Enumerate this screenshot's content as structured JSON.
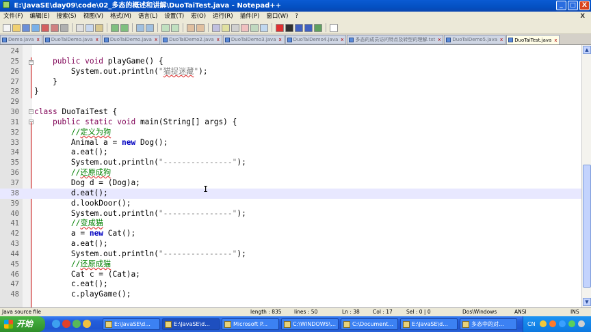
{
  "window": {
    "title": "E:\\JavaSE\\day09\\code\\02_多态的概述和讲解\\DuoTaiTest.java - Notepad++",
    "controls": [
      "_",
      "□",
      "X"
    ]
  },
  "menu": {
    "items": [
      "文件(F)",
      "编辑(E)",
      "搜索(S)",
      "视图(V)",
      "格式(M)",
      "语言(L)",
      "设置(T)",
      "宏(O)",
      "运行(R)",
      "插件(P)",
      "窗口(W)",
      "?"
    ],
    "close": "X"
  },
  "toolbar": {
    "icons": [
      "new-icon",
      "open-icon",
      "save-icon",
      "save-all-icon",
      "close-icon",
      "close-all-icon",
      "print-icon",
      "cut-icon",
      "copy-icon",
      "paste-icon",
      "undo-icon",
      "redo-icon",
      "find-icon",
      "replace-icon",
      "zoom-in-icon",
      "zoom-out-icon",
      "sync-v-icon",
      "sync-h-icon",
      "wrap-icon",
      "all-chars-icon",
      "indent-guide-icon",
      "udl-icon",
      "doc-map-icon",
      "function-list-icon",
      "record-icon",
      "stop-icon",
      "play-icon",
      "play-multi-icon",
      "save-macro-icon",
      "spellcheck-icon"
    ]
  },
  "tabs": [
    {
      "label": "Demo.java",
      "active": false
    },
    {
      "label": "DuoTaiDemo.java",
      "active": false
    },
    {
      "label": "DuoTaiDemo.java",
      "active": false
    },
    {
      "label": "DuoTaiDemo2.java",
      "active": false
    },
    {
      "label": "DuoTaiDemo3.java",
      "active": false
    },
    {
      "label": "DuoTaiDemo4.java",
      "active": false
    },
    {
      "label": "多态的成员访问特点及转型的理解.txt",
      "active": false
    },
    {
      "label": "DuoTaiDemo5.java",
      "active": false
    },
    {
      "label": "DuoTaiTest.java",
      "active": true
    }
  ],
  "editor": {
    "current_line": 38,
    "lines": [
      {
        "n": "24",
        "parts": [
          {
            "t": ""
          }
        ]
      },
      {
        "n": "25",
        "parts": [
          {
            "t": "    "
          },
          {
            "t": "public void",
            "c": "kw"
          },
          {
            "t": " playGame() {"
          }
        ]
      },
      {
        "n": "26",
        "parts": [
          {
            "t": "        System.out.println("
          },
          {
            "t": "\"",
            "c": "st"
          },
          {
            "t": "猫捉迷藏",
            "c": "st cn"
          },
          {
            "t": "\"",
            "c": "st"
          },
          {
            "t": ");"
          }
        ]
      },
      {
        "n": "27",
        "parts": [
          {
            "t": "    }"
          }
        ]
      },
      {
        "n": "28",
        "parts": [
          {
            "t": "}"
          }
        ]
      },
      {
        "n": "29",
        "parts": [
          {
            "t": ""
          }
        ]
      },
      {
        "n": "30",
        "parts": [
          {
            "t": "class",
            "c": "kw"
          },
          {
            "t": " DuoTaiTest {"
          }
        ]
      },
      {
        "n": "31",
        "parts": [
          {
            "t": "    "
          },
          {
            "t": "public static void",
            "c": "kw"
          },
          {
            "t": " main(String[] args) {"
          }
        ]
      },
      {
        "n": "32",
        "parts": [
          {
            "t": "        "
          },
          {
            "t": "//",
            "c": "cm"
          },
          {
            "t": "定义为狗",
            "c": "cm cn"
          }
        ]
      },
      {
        "n": "33",
        "parts": [
          {
            "t": "        Animal a = "
          },
          {
            "t": "new",
            "c": "kw2"
          },
          {
            "t": " Dog();"
          }
        ]
      },
      {
        "n": "34",
        "parts": [
          {
            "t": "        a.eat();"
          }
        ]
      },
      {
        "n": "35",
        "parts": [
          {
            "t": "        System.out.println("
          },
          {
            "t": "\"---------------\"",
            "c": "st"
          },
          {
            "t": ");"
          }
        ]
      },
      {
        "n": "36",
        "parts": [
          {
            "t": "        "
          },
          {
            "t": "//",
            "c": "cm"
          },
          {
            "t": "还原成狗",
            "c": "cm cn"
          }
        ]
      },
      {
        "n": "37",
        "parts": [
          {
            "t": "        Dog d = (Dog)a;"
          }
        ]
      },
      {
        "n": "38",
        "parts": [
          {
            "t": "        d.eat();"
          }
        ]
      },
      {
        "n": "39",
        "parts": [
          {
            "t": "        d.lookDoor();"
          }
        ]
      },
      {
        "n": "40",
        "parts": [
          {
            "t": "        System.out.println("
          },
          {
            "t": "\"---------------\"",
            "c": "st"
          },
          {
            "t": ");"
          }
        ]
      },
      {
        "n": "41",
        "parts": [
          {
            "t": "        "
          },
          {
            "t": "//",
            "c": "cm"
          },
          {
            "t": "变成猫",
            "c": "cm cn"
          }
        ]
      },
      {
        "n": "42",
        "parts": [
          {
            "t": "        a = "
          },
          {
            "t": "new",
            "c": "kw2"
          },
          {
            "t": " Cat();"
          }
        ]
      },
      {
        "n": "43",
        "parts": [
          {
            "t": "        a.eat();"
          }
        ]
      },
      {
        "n": "44",
        "parts": [
          {
            "t": "        System.out.println("
          },
          {
            "t": "\"---------------\"",
            "c": "st"
          },
          {
            "t": ");"
          }
        ]
      },
      {
        "n": "45",
        "parts": [
          {
            "t": "        "
          },
          {
            "t": "//",
            "c": "cm"
          },
          {
            "t": "还原成猫",
            "c": "cm cn"
          }
        ]
      },
      {
        "n": "46",
        "parts": [
          {
            "t": "        Cat c = (Cat)a;"
          }
        ]
      },
      {
        "n": "47",
        "parts": [
          {
            "t": "        c.eat();"
          }
        ]
      },
      {
        "n": "48",
        "parts": [
          {
            "t": "        c.playGame();"
          }
        ]
      }
    ]
  },
  "status": {
    "filetype": "Java source file",
    "length": "length : 835",
    "lines": "lines : 50",
    "ln": "Ln : 38",
    "col": "Col : 17",
    "sel": "Sel : 0 | 0",
    "eol": "Dos\\Windows",
    "encoding": "ANSI",
    "mode": "INS"
  },
  "taskbar": {
    "start_label": "开始",
    "tasks": [
      {
        "label": "E:\\JavaSE\\d...",
        "active": false
      },
      {
        "label": "E:\\JavaSE\\d...",
        "active": true
      },
      {
        "label": "Microsoft P...",
        "active": false
      },
      {
        "label": "C:\\WINDOWS\\...",
        "active": false
      },
      {
        "label": "C:\\Document...",
        "active": false
      },
      {
        "label": "E:\\JavaSE\\d...",
        "active": false
      },
      {
        "label": "多态中的对...",
        "active": false
      }
    ],
    "tray_lang": "CN"
  },
  "colors": {
    "titlebar": "#0450c2",
    "keyword": "#7f0055",
    "new_keyword": "#0000c0",
    "comment": "#008000",
    "string": "#808080",
    "current_line": "#e8e8ff"
  }
}
